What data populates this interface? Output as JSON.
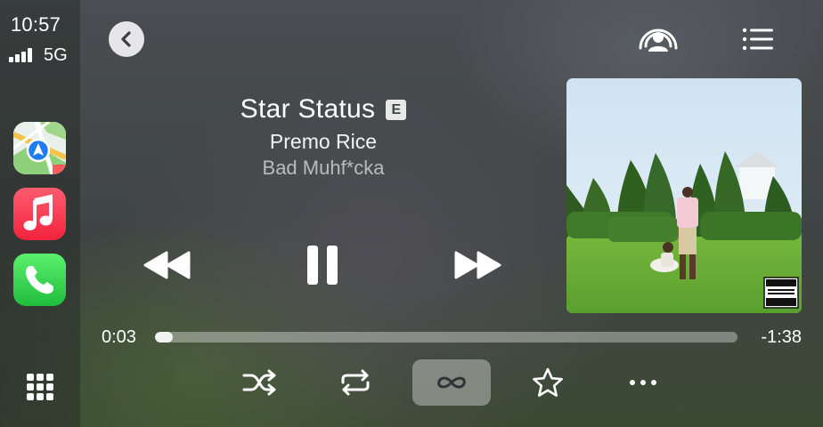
{
  "status": {
    "time": "10:57",
    "network": "5G"
  },
  "sidebar": {
    "apps": [
      {
        "name": "Maps",
        "icon": "maps-icon"
      },
      {
        "name": "Music",
        "icon": "music-icon"
      },
      {
        "name": "Phone",
        "icon": "phone-icon"
      }
    ],
    "home_icon": "app-grid-icon"
  },
  "now_playing": {
    "title": "Star Status",
    "explicit_badge": "E",
    "artist": "Premo Rice",
    "album": "Bad Muhf*cka",
    "elapsed": "0:03",
    "remaining": "-1:38",
    "progress_fraction": 0.03
  },
  "controls": {
    "top": [
      "back-icon",
      "airplay-icon",
      "queue-list-icon"
    ],
    "transport": [
      "rewind-icon",
      "pause-icon",
      "fast-forward-icon"
    ],
    "bottom": [
      "shuffle-icon",
      "repeat-icon",
      "infinity-autoplay-icon",
      "star-icon",
      "more-icon"
    ],
    "autoplay_active": true
  },
  "colors": {
    "accent": "#f2f2f2",
    "music_app": "#f2233f",
    "phone_app": "#1fbd3c"
  }
}
